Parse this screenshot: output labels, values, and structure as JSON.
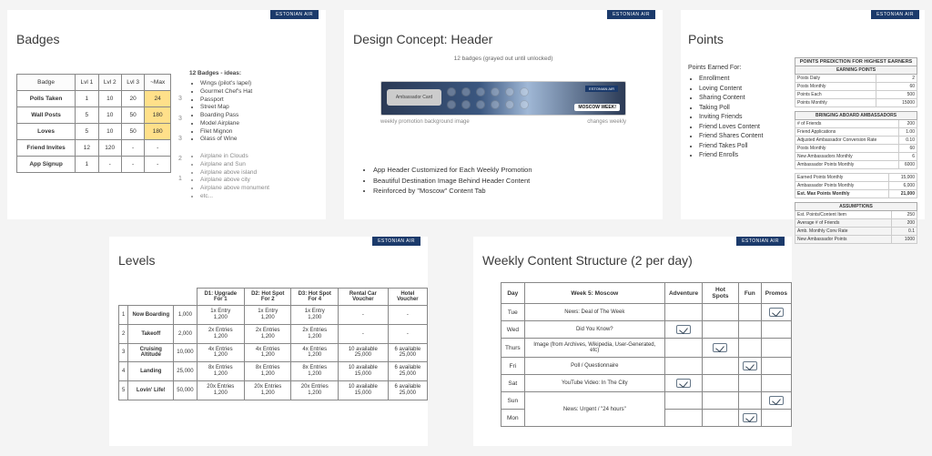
{
  "brand": "ESTONIAN AIR",
  "badges": {
    "title": "Badges",
    "cols": [
      "Badge",
      "Lvl 1",
      "Lvl 2",
      "Lvl 3",
      "~Max"
    ],
    "rows": [
      {
        "name": "Polls Taken",
        "v": [
          "1",
          "10",
          "20",
          "24"
        ],
        "hl": true,
        "side": "3"
      },
      {
        "name": "Wall Posts",
        "v": [
          "5",
          "10",
          "50",
          "180"
        ],
        "hl": true,
        "side": "3"
      },
      {
        "name": "Loves",
        "v": [
          "5",
          "10",
          "50",
          "180"
        ],
        "hl": true,
        "side": "3"
      },
      {
        "name": "Friend Invites",
        "v": [
          "12",
          "120",
          "-",
          "-"
        ],
        "hl": false,
        "side": "2"
      },
      {
        "name": "App Signup",
        "v": [
          "1",
          "-",
          "-",
          "-"
        ],
        "hl": false,
        "side": "1"
      }
    ],
    "ideas_head": "12 Badges - ideas:",
    "ideas": [
      "Wings (pilot's lapel)",
      "Gourmet Chef's Hat",
      "Passport",
      "Street Map",
      "Boarding Pass",
      "Model Airplane",
      "Filet Mignon",
      "Glass of Wine"
    ],
    "ideas2": [
      "Airplane in Clouds",
      "Airplane and Sun",
      "Airplane above island",
      "Airplane above city",
      "Airplane above monument",
      "etc..."
    ]
  },
  "design": {
    "title": "Design Concept: Header",
    "cap_top": "12 badges (grayed out until unlocked)",
    "amb_card": "Ambassador Card",
    "moscow": "MOSCOW WEEK!",
    "note_left": "weekly promotion background image",
    "note_right": "changes weekly",
    "bullets": [
      "App Header Customized for Each Weekly Promotion",
      "Beautiful Destination Image Behind Header Content",
      "Reinforced by \"Moscow\" Content Tab"
    ]
  },
  "points": {
    "title": "Points",
    "lead": "Points Earned For:",
    "items": [
      "Enrollment",
      "Loving Content",
      "Sharing Content",
      "Taking Poll",
      "Inviting Friends",
      "Friend Loves Content",
      "Friend Shares Content",
      "Friend Takes Poll",
      "Friend Enrolls"
    ],
    "pred_title": "POINTS PREDICTION FOR HIGHEST EARNERS",
    "sec1": {
      "head": "EARNING POINTS",
      "rows": [
        {
          "l": "Posts Daily",
          "r": "2"
        },
        {
          "l": "Posts Monthly",
          "r": "60"
        },
        {
          "l": "Points Each",
          "r": "500"
        },
        {
          "l": "Points Monthly",
          "r": "15000"
        }
      ]
    },
    "sec2": {
      "head": "BRINGING ABOARD AMBASSADORS",
      "rows": [
        {
          "l": "# of Friends",
          "r": "200"
        },
        {
          "l": "Friend Applications",
          "r": "1.00"
        },
        {
          "l": "Adjusted Ambassador Conversion Rate",
          "r": "0.10"
        },
        {
          "l": "Posts Monthly",
          "r": "60"
        },
        {
          "l": "New Ambassadors Monthly",
          "r": "6"
        },
        {
          "l": "Ambassador Points Monthly",
          "r": "6000"
        }
      ]
    },
    "sec3": [
      {
        "l": "Earned Points Monthly",
        "r": "15,000"
      },
      {
        "l": "Ambassador Points Monthly",
        "r": "6,000"
      },
      {
        "l": "Est. Max Points Monthly",
        "r": "21,000",
        "bold": true
      }
    ],
    "sec4": {
      "head": "ASSUMPTIONS",
      "rows": [
        {
          "l": "Est. Points/Content Item",
          "r": "250"
        },
        {
          "l": "Average # of Friends",
          "r": "200"
        },
        {
          "l": "Amb. Monthly Conv Rate",
          "r": "0.1"
        },
        {
          "l": "New Ambassador Points",
          "r": "1000"
        }
      ]
    }
  },
  "levels": {
    "title": "Levels",
    "cols": [
      "",
      "",
      "",
      "D1: Upgrade For 1",
      "D2: Hot Spot For 2",
      "D3: Hot Spot For 4",
      "Rental Car Voucher",
      "Hotel Voucher"
    ],
    "rows": [
      {
        "n": "1",
        "name": "Now Boarding",
        "pts": "1,000",
        "d1": "1x Entry\n1,200",
        "d2": "1x Entry\n1,200",
        "d3": "1x Entry\n1,200",
        "rc": "-",
        "hv": "-"
      },
      {
        "n": "2",
        "name": "Takeoff",
        "pts": "2,000",
        "d1": "2x Entries\n1,200",
        "d2": "2x Entries\n1,200",
        "d3": "2x Entries\n1,200",
        "rc": "-",
        "hv": "-"
      },
      {
        "n": "3",
        "name": "Cruising Altitude",
        "pts": "10,000",
        "d1": "4x Entries\n1,200",
        "d2": "4x Entries\n1,200",
        "d3": "4x Entries\n1,200",
        "rc": "10 available\n25,000",
        "hv": "6 available\n25,000"
      },
      {
        "n": "4",
        "name": "Landing",
        "pts": "25,000",
        "d1": "8x Entries\n1,200",
        "d2": "8x Entries\n1,200",
        "d3": "8x Entries\n1,200",
        "rc": "10 available\n15,000",
        "hv": "6 available\n25,000"
      },
      {
        "n": "5",
        "name": "Lovin' Life!",
        "pts": "50,000",
        "d1": "20x Entries\n1,200",
        "d2": "20x Entries\n1,200",
        "d3": "20x Entries\n1,200",
        "rc": "10 available\n15,000",
        "hv": "6 available\n25,000"
      }
    ]
  },
  "weekly": {
    "title": "Weekly Content Structure (2 per day)",
    "cols": [
      "Day",
      "Week 5: Moscow",
      "Adventure",
      "Hot Spots",
      "Fun",
      "Promos"
    ],
    "rows": [
      {
        "day": "Tue",
        "content": "News: Deal of The Week",
        "checks": [
          false,
          false,
          false,
          true
        ]
      },
      {
        "day": "Wed",
        "content": "Did You Know?",
        "checks": [
          true,
          false,
          false,
          false
        ]
      },
      {
        "day": "Thurs",
        "content": "Image (from Archives, Wikipedia, User-Generated, etc)",
        "checks": [
          false,
          true,
          false,
          false
        ]
      },
      {
        "day": "Fri",
        "content": "Poll / Questionnaire",
        "checks": [
          false,
          false,
          true,
          false
        ]
      },
      {
        "day": "Sat",
        "content": "YouTube Video: In The City",
        "checks": [
          true,
          false,
          false,
          false
        ]
      },
      {
        "day": "Sun",
        "content": "",
        "checks": [
          false,
          false,
          false,
          true
        ]
      },
      {
        "day": "Mon",
        "content": "News: Urgent / \"24 hours\"",
        "merge_up": true,
        "checks": [
          false,
          false,
          true,
          false
        ]
      }
    ],
    "sun_mon_content": "News: Urgent / \"24 hours\""
  }
}
